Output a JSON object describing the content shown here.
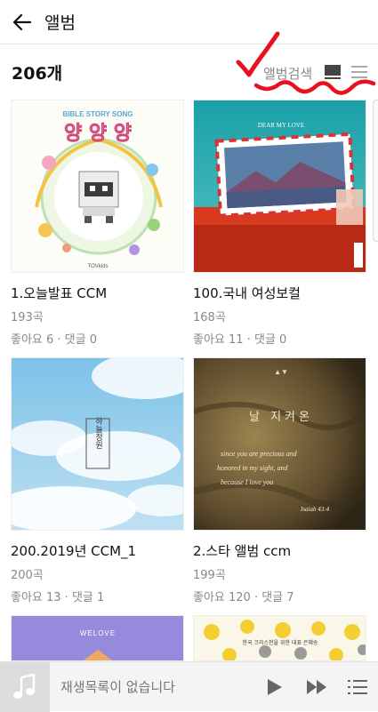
{
  "header": {
    "title": "앨범"
  },
  "toolbar": {
    "count": "206개",
    "search_label": "앨범검색"
  },
  "albums": [
    {
      "name": "1.오늘발표 CCM",
      "tracks": "193곡",
      "stats": "좋아요 6 · 댓글 0",
      "cover_title": "양 양 양",
      "cover_top": "BIBLE STORY SONG",
      "cover_brand": "TOVkids"
    },
    {
      "name": "100.국내 여성보컬",
      "tracks": "168곡",
      "stats": "좋아요 11 · 댓글 0",
      "cover_top": "DEAR MY LOVE"
    },
    {
      "name": "200.2019년 CCM_1",
      "tracks": "200곡",
      "stats": "좋아요 13 · 댓글 1",
      "cover_title": "하늘정원"
    },
    {
      "name": "2.스타 앨범 ccm",
      "tracks": "199곡",
      "stats": "좋아요 120 · 댓글 7",
      "cover_title": "날 지켜온",
      "cover_script_1": "since you are precious and",
      "cover_script_2": "honored in my sight, and",
      "cover_script_3": "because I love you",
      "cover_ref": "Isaiah 43:4"
    },
    {
      "name": "",
      "tracks": "",
      "stats": "",
      "cover_top": "WELOVE"
    },
    {
      "name": "",
      "tracks": "",
      "stats": "",
      "cover_top": "한국 크리스천을 위한 대표 은혜송"
    }
  ],
  "player": {
    "status": "재생목록이 없습니다"
  },
  "colors": {
    "annotation": "#e8121f",
    "accent": "#111111"
  }
}
